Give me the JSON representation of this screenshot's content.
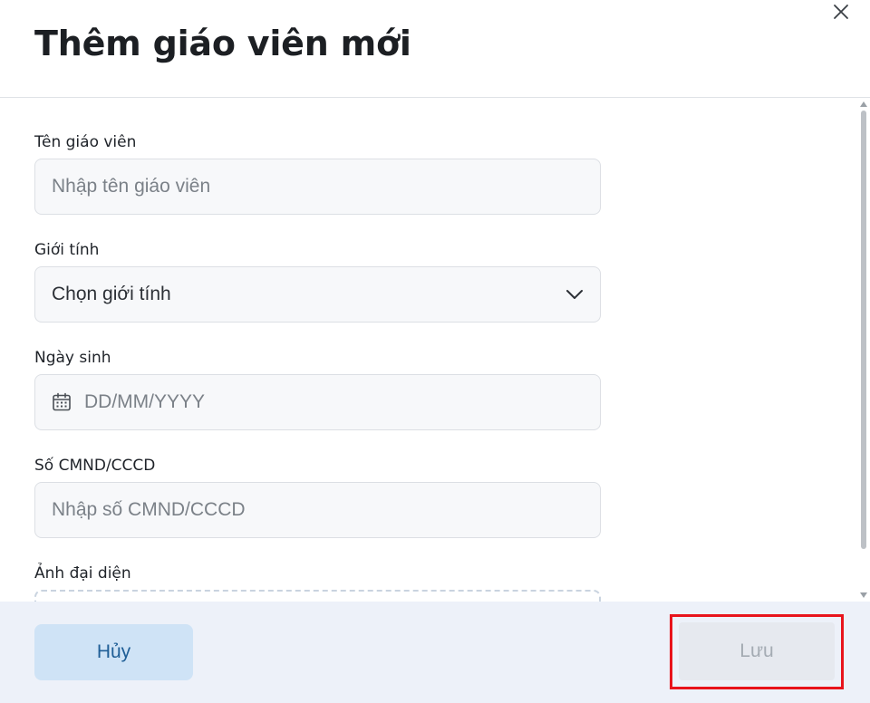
{
  "dialog": {
    "title": "Thêm giáo viên mới"
  },
  "form": {
    "teacher_name": {
      "label": "Tên giáo viên",
      "placeholder": "Nhập tên giáo viên",
      "value": ""
    },
    "gender": {
      "label": "Giới tính",
      "selected": "Chọn giới tính"
    },
    "birthday": {
      "label": "Ngày sinh",
      "placeholder": "DD/MM/YYYY"
    },
    "id_number": {
      "label": "Số CMND/CCCD",
      "placeholder": "Nhập số CMND/CCCD"
    },
    "avatar": {
      "label": "Ảnh đại diện"
    }
  },
  "footer": {
    "cancel_label": "Hủy",
    "save_label": "Lưu"
  },
  "icons": {
    "close": "close-icon",
    "chevron": "chevron-down-icon",
    "calendar": "calendar-icon"
  },
  "colors": {
    "cancel_bg": "#cfe3f6",
    "save_bg_disabled": "#e6e9ef",
    "footer_bg": "#edf1f9",
    "highlight": "#e8141c"
  }
}
